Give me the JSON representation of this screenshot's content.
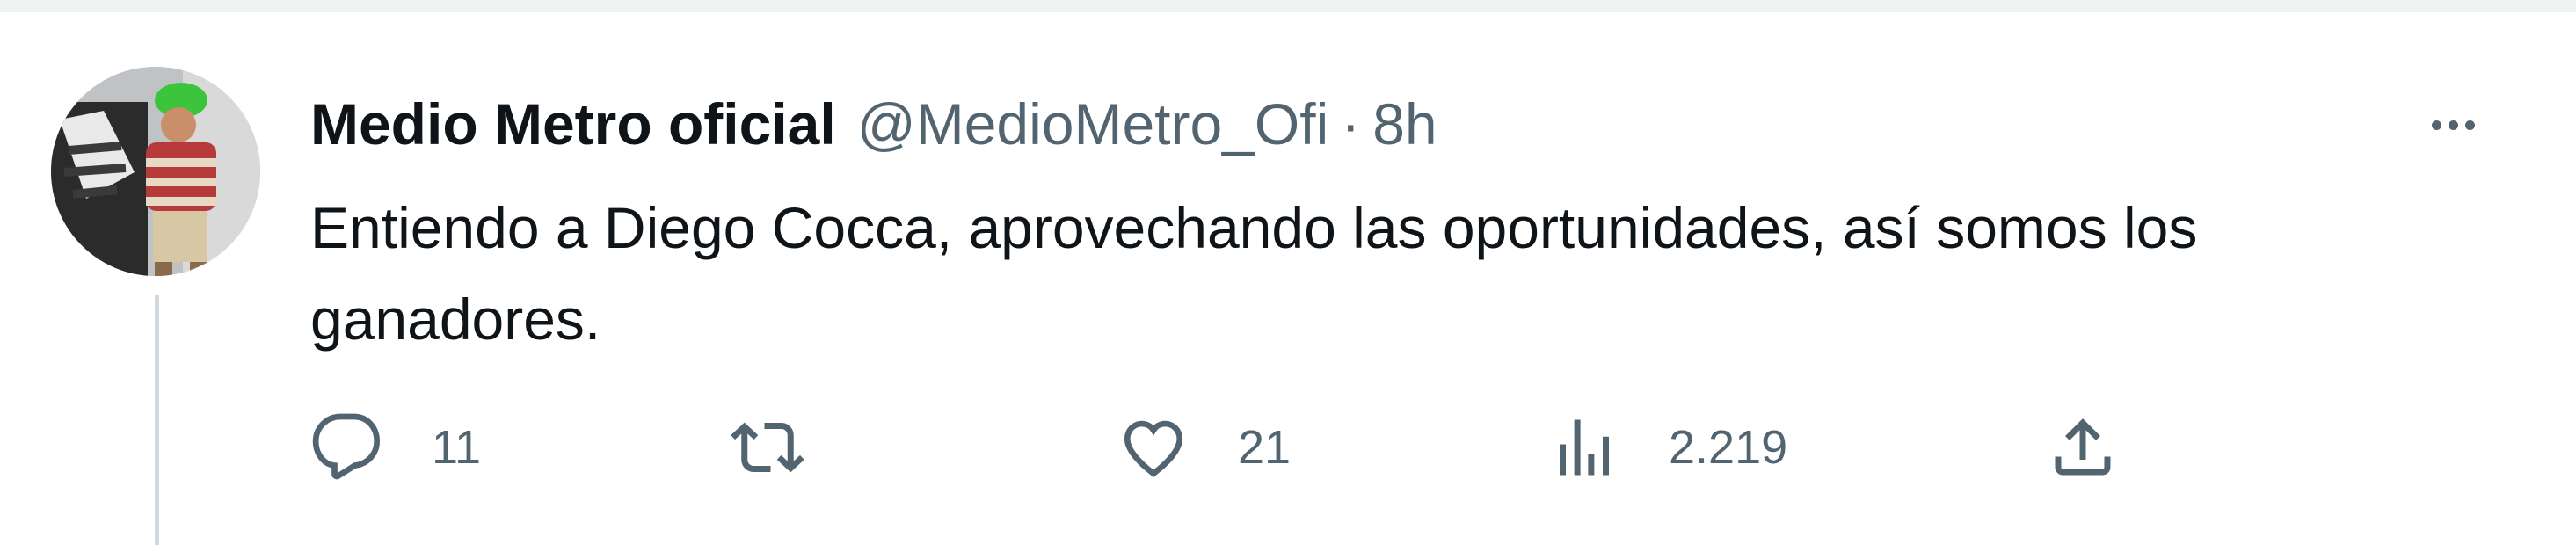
{
  "tweet": {
    "display_name": "Medio Metro oficial",
    "handle": "@MedioMetro_Ofi",
    "separator": "·",
    "time": "8h",
    "text": "Entiendo a Diego Cocca, aprovechando las oportunidades, así somos los ganadores."
  },
  "actions": {
    "replies": "11",
    "retweets": "",
    "likes": "21",
    "views": "2.219"
  },
  "icons": {
    "reply": "reply-icon",
    "retweet": "retweet-icon",
    "like": "heart-icon",
    "views": "views-icon",
    "share": "share-icon",
    "more": "more-icon"
  },
  "colors": {
    "text": "#0f1419",
    "secondary": "#536471",
    "border": "#eff3f4",
    "thread_line": "#cfd9de"
  }
}
